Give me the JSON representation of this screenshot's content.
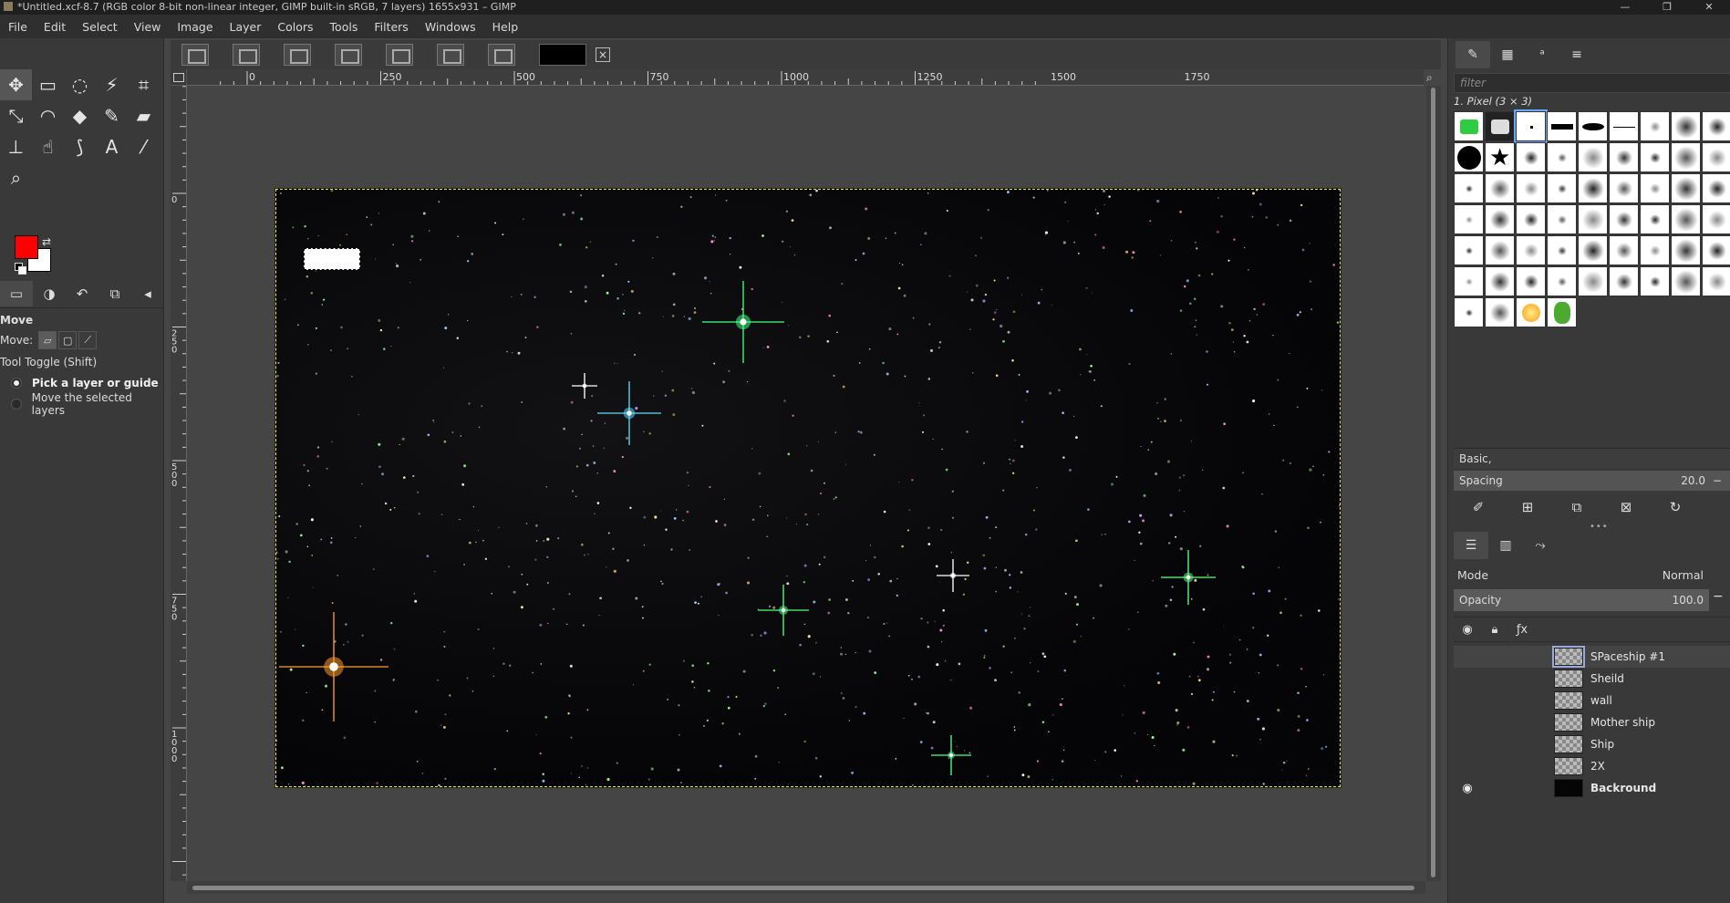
{
  "window": {
    "title": "*Untitled.xcf-8.7 (RGB color 8-bit non-linear integer, GIMP built-in sRGB, 7 layers) 1655x931 – GIMP",
    "controls": [
      "—",
      "❐",
      "✕"
    ]
  },
  "menu": [
    "File",
    "Edit",
    "Select",
    "View",
    "Image",
    "Layer",
    "Colors",
    "Tools",
    "Filters",
    "Windows",
    "Help"
  ],
  "tools": [
    {
      "name": "move-tool",
      "glyph": "✥"
    },
    {
      "name": "rect-select-tool",
      "glyph": "▭"
    },
    {
      "name": "free-select-tool",
      "glyph": "◌"
    },
    {
      "name": "fuzzy-select-tool",
      "glyph": "⚡"
    },
    {
      "name": "crop-tool",
      "glyph": "⌗"
    },
    {
      "name": "transform-tool",
      "glyph": "⤡"
    },
    {
      "name": "warp-tool",
      "glyph": "◠"
    },
    {
      "name": "bucket-fill-tool",
      "glyph": "◆"
    },
    {
      "name": "paintbrush-tool",
      "glyph": "✎"
    },
    {
      "name": "eraser-tool",
      "glyph": "▰"
    },
    {
      "name": "clone-tool",
      "glyph": "⊥"
    },
    {
      "name": "smudge-tool",
      "glyph": "☝"
    },
    {
      "name": "paths-tool",
      "glyph": "⟆"
    },
    {
      "name": "text-tool",
      "glyph": "A"
    },
    {
      "name": "color-picker-tool",
      "glyph": "⁄"
    },
    {
      "name": "zoom-tool",
      "glyph": "⌕"
    }
  ],
  "colors": {
    "foreground": "#ff0000",
    "background": "#ffffff"
  },
  "tool_options": {
    "title": "Move",
    "move_label": "Move:",
    "toggle_label": "Tool Toggle  (Shift)",
    "option_pick": "Pick a layer or guide",
    "option_move": "Move the selected layers"
  },
  "rulers": {
    "horizontal": [
      "0",
      "250",
      "500",
      "750",
      "1000",
      "1250",
      "1500",
      "1750"
    ],
    "vertical": [
      "0",
      "250",
      "500",
      "750",
      "1000"
    ]
  },
  "image_tabs_count": 7,
  "brushes": {
    "filter_placeholder": "filter",
    "selected": "1. Pixel (3 × 3)",
    "preset": "Basic,",
    "spacing_label": "Spacing",
    "spacing_value": "20.0"
  },
  "layers": {
    "mode_label": "Mode",
    "mode_value": "Normal",
    "opacity_label": "Opacity",
    "opacity_value": "100.0",
    "items": [
      {
        "name": "SPaceship #1",
        "visible": false,
        "bold": false,
        "thumb": "checker",
        "selected": true
      },
      {
        "name": "Sheild",
        "visible": false,
        "bold": false,
        "thumb": "checker",
        "selected": false
      },
      {
        "name": "wall",
        "visible": false,
        "bold": false,
        "thumb": "checker",
        "selected": false
      },
      {
        "name": "Mother ship",
        "visible": false,
        "bold": false,
        "thumb": "checker",
        "selected": false
      },
      {
        "name": "Ship",
        "visible": false,
        "bold": false,
        "thumb": "checker",
        "selected": false
      },
      {
        "name": "2X",
        "visible": false,
        "bold": false,
        "thumb": "checker",
        "selected": false
      },
      {
        "name": "Backround",
        "visible": true,
        "bold": true,
        "thumb": "dark",
        "selected": false
      }
    ]
  }
}
